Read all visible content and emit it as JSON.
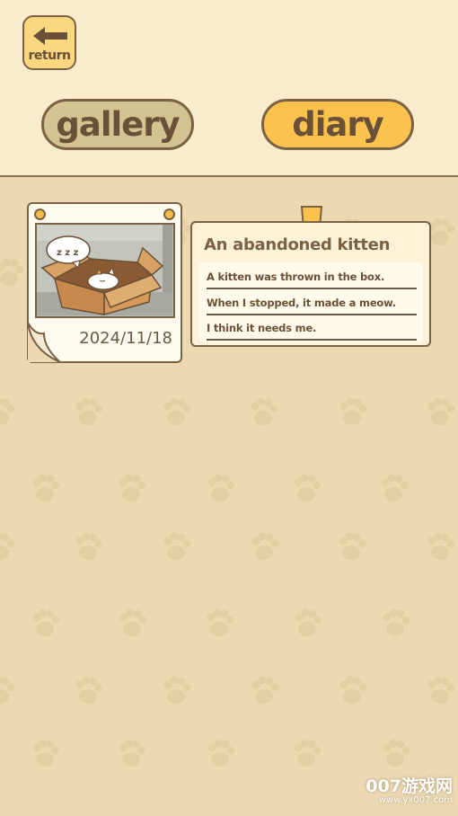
{
  "header": {
    "return_label": "return",
    "tabs": [
      {
        "label": "gallery",
        "active": false
      },
      {
        "label": "diary",
        "active": true
      }
    ]
  },
  "entry": {
    "date": "2024/11/18",
    "title": "An abandoned kitten",
    "lines": [
      "A kitten was thrown in the box.",
      "When I stopped, it made a meow.",
      "I think it needs me."
    ]
  },
  "watermark": {
    "brand": "007游戏网",
    "url": "www.yx007.com"
  },
  "colors": {
    "header_bg": "#fbeccb",
    "content_bg": "#ecd9b2",
    "active_tab": "#fbc24e",
    "inactive_tab": "#d2c391",
    "outline": "#7a6245"
  }
}
